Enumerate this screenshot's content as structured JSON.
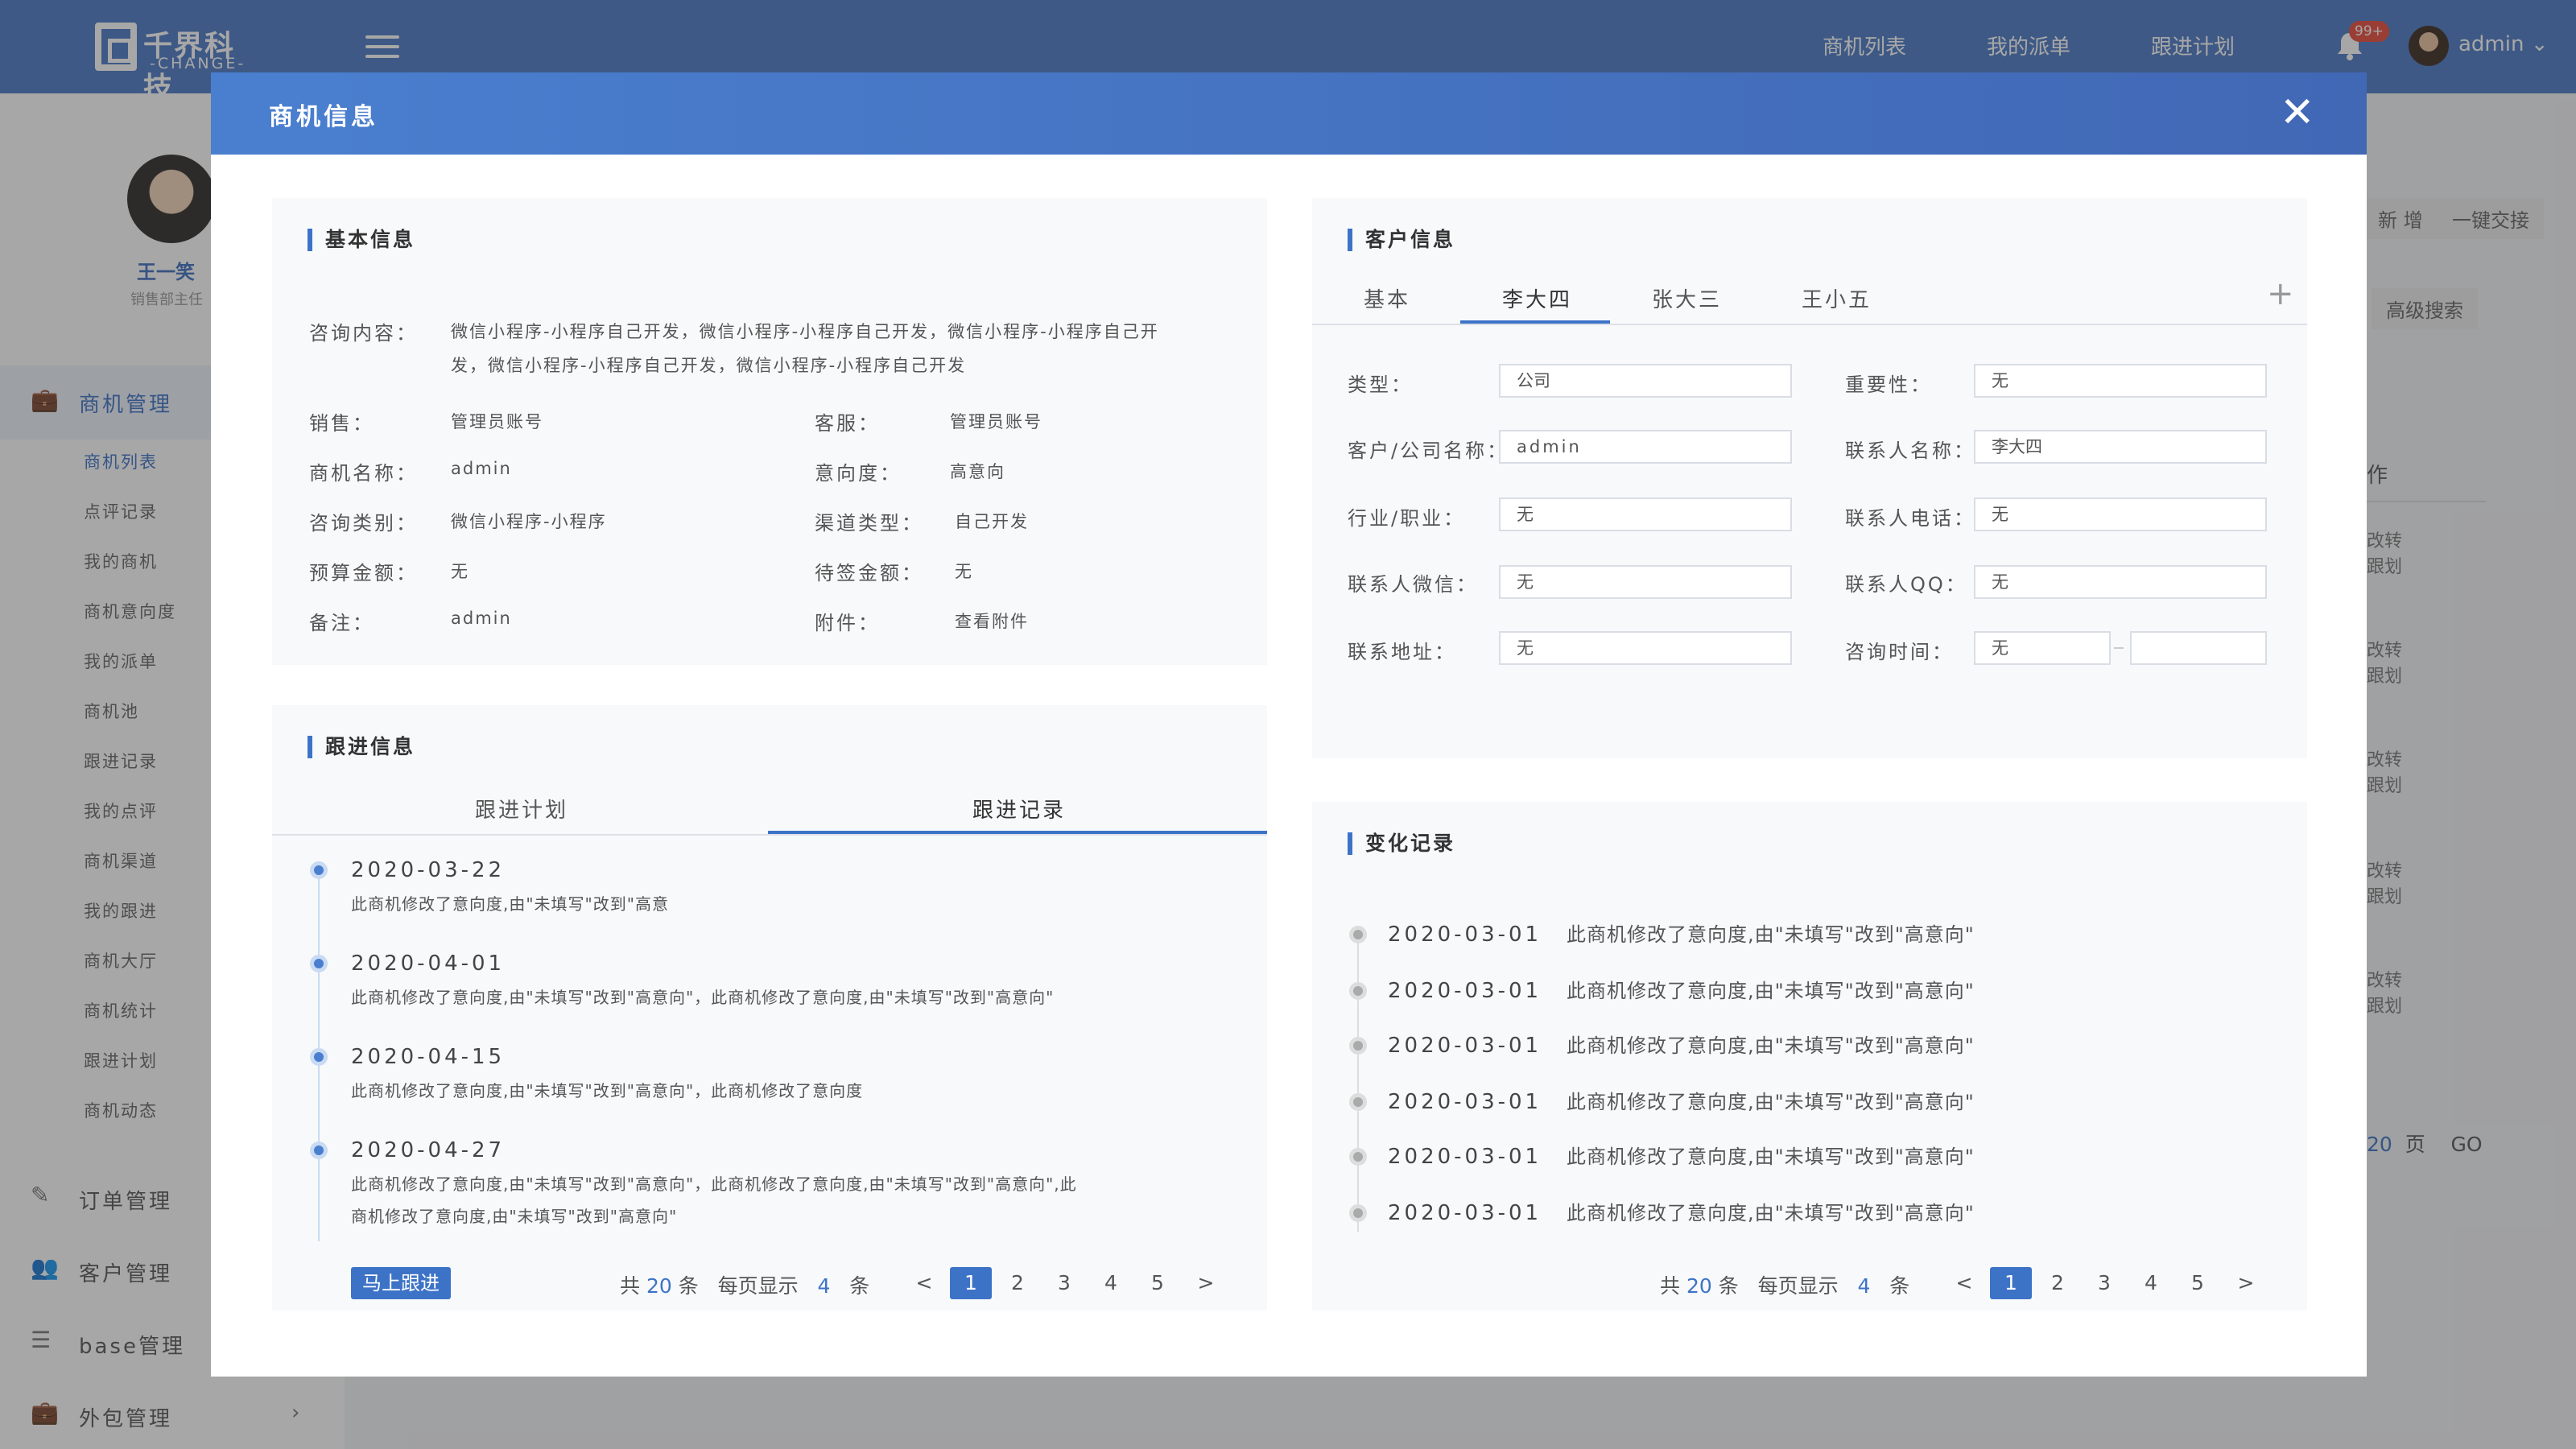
{
  "brand": {
    "name_cn": "千界科技",
    "name_en": "-CHANGE-"
  },
  "topnav": {
    "items": [
      "商机列表",
      "我的派单",
      "跟进计划"
    ],
    "badge": "99+",
    "user": "admin"
  },
  "profile": {
    "name": "王一笑",
    "role": "销售部主任"
  },
  "sidebar": {
    "sections": [
      {
        "label": "商机管理",
        "icon": "briefcase-icon",
        "active": true
      },
      {
        "label": "订单管理",
        "icon": "edit-icon"
      },
      {
        "label": "客户管理",
        "icon": "users-icon"
      },
      {
        "label": "base管理",
        "icon": "list-icon"
      },
      {
        "label": "外包管理",
        "icon": "briefcase-icon"
      }
    ],
    "subitems": [
      "商机列表",
      "点评记录",
      "我的商机",
      "商机意向度",
      "我的派单",
      "商机池",
      "跟进记录",
      "我的点评",
      "商机渠道",
      "我的跟进",
      "商机大厅",
      "商机统计",
      "跟进计划",
      "商机动态"
    ]
  },
  "background": {
    "btn_new": "新 增",
    "btn_transfer": "一键交接",
    "btn_search": "高级搜索",
    "col_ops": "作",
    "op_labels": [
      "改",
      "转",
      "跟",
      "划"
    ],
    "pg_total": "20",
    "pg_unit": "页",
    "pg_go": "GO"
  },
  "modal": {
    "title": "商机信息"
  },
  "basic": {
    "title": "基本信息",
    "consult_label": "咨询内容：",
    "consult_value_1": "微信小程序-小程序自己开发，微信小程序-小程序自己开发，微信小程序-小程序自己开",
    "consult_value_2": "发，微信小程序-小程序自己开发，微信小程序-小程序自己开发",
    "rows": [
      {
        "l1": "销售：",
        "v1": "管理员账号",
        "l2": "客服：",
        "v2": "管理员账号"
      },
      {
        "l1": "商机名称：",
        "v1": "admin",
        "l2": "意向度：",
        "v2": "高意向"
      },
      {
        "l1": "咨询类别：",
        "v1": "微信小程序-小程序",
        "l2": "渠道类型：",
        "v2": "自己开发"
      },
      {
        "l1": "预算金额：",
        "v1": "无",
        "l2": "待签金额：",
        "v2": "无"
      },
      {
        "l1": "备注：",
        "v1": "admin",
        "l2": "附件：",
        "v2": "查看附件"
      }
    ]
  },
  "customer": {
    "title": "客户信息",
    "tabs": [
      "基本",
      "李大四",
      "张大三",
      "王小五"
    ],
    "active_tab": 1,
    "fields": [
      {
        "l1": "类型：",
        "v1": "公司",
        "l2": "重要性：",
        "v2": "无"
      },
      {
        "l1": "客户/公司名称：",
        "v1": "admin",
        "l2": "联系人名称：",
        "v2": "李大四"
      },
      {
        "l1": "行业/职业：",
        "v1": "无",
        "l2": "联系人电话：",
        "v2": "无"
      },
      {
        "l1": "联系人微信：",
        "v1": "无",
        "l2": "联系人QQ：",
        "v2": "无"
      },
      {
        "l1": "联系地址：",
        "v1": "无",
        "l2": "咨询时间：",
        "v2": "无",
        "v3": ""
      }
    ]
  },
  "followup": {
    "title": "跟进信息",
    "tabs": [
      "跟进计划",
      "跟进记录"
    ],
    "active_tab": 1,
    "entries": [
      {
        "date": "2020-03-22",
        "lines": [
          "此商机修改了意向度,由\"未填写\"改到\"高意"
        ]
      },
      {
        "date": "2020-04-01",
        "lines": [
          "此商机修改了意向度,由\"未填写\"改到\"高意向\"，此商机修改了意向度,由\"未填写\"改到\"高意向\""
        ]
      },
      {
        "date": "2020-04-15",
        "lines": [
          "此商机修改了意向度,由\"未填写\"改到\"高意向\"，此商机修改了意向度"
        ]
      },
      {
        "date": "2020-04-27",
        "lines": [
          "此商机修改了意向度,由\"未填写\"改到\"高意向\"，此商机修改了意向度,由\"未填写\"改到\"高意向\",此",
          "商机修改了意向度,由\"未填写\"改到\"高意向\""
        ]
      }
    ],
    "button": "马上跟进"
  },
  "changes": {
    "title": "变化记录",
    "entries": [
      {
        "date": "2020-03-01",
        "text": "此商机修改了意向度,由\"未填写\"改到\"高意向\""
      },
      {
        "date": "2020-03-01",
        "text": "此商机修改了意向度,由\"未填写\"改到\"高意向\""
      },
      {
        "date": "2020-03-01",
        "text": "此商机修改了意向度,由\"未填写\"改到\"高意向\""
      },
      {
        "date": "2020-03-01",
        "text": "此商机修改了意向度,由\"未填写\"改到\"高意向\""
      },
      {
        "date": "2020-03-01",
        "text": "此商机修改了意向度,由\"未填写\"改到\"高意向\""
      },
      {
        "date": "2020-03-01",
        "text": "此商机修改了意向度,由\"未填写\"改到\"高意向\""
      }
    ]
  },
  "pagination": {
    "total_prefix": "共",
    "total": "20",
    "total_suffix": "条",
    "per_page_label": "每页显示",
    "per_page": "4",
    "per_page_unit": "条",
    "prev": "<",
    "next": ">",
    "pages": [
      "1",
      "2",
      "3",
      "4",
      "5"
    ],
    "current": "1"
  },
  "colors": {
    "primary": "#3d73c7",
    "header": "#4b79c5",
    "badge": "#e84b3c"
  }
}
